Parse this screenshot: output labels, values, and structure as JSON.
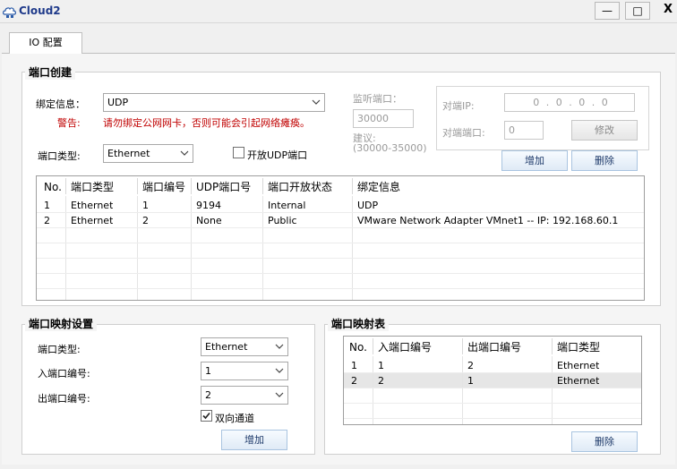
{
  "window": {
    "title": "Cloud2",
    "min_label": "—",
    "max_label": "□",
    "close_label": "X"
  },
  "tabs": [
    {
      "label": "IO 配置"
    }
  ],
  "port_create": {
    "group_title": "端口创建",
    "binding_label": "绑定信息：",
    "binding_value": "UDP",
    "warning_label": "警告:",
    "warning_text": "请勿绑定公网网卡，否则可能会引起网络瘫痪。",
    "listen_port_label": "监听端口：",
    "listen_port_value": "30000",
    "suggest_label": "建议:",
    "suggest_range": "(30000-35000)",
    "peer_ip_label": "对端IP:",
    "peer_ip_value": "0 . 0 . 0 . 0",
    "peer_port_label": "对端端口:",
    "peer_port_value": "0",
    "modify_button": "修改",
    "port_type_label": "端口类型:",
    "port_type_value": "Ethernet",
    "open_udp_label": "开放UDP端口",
    "open_udp_checked": false,
    "add_button": "增加",
    "delete_button": "删除",
    "table": {
      "columns": [
        "No.",
        "端口类型",
        "端口编号",
        "UDP端口号",
        "端口开放状态",
        "绑定信息"
      ],
      "rows": [
        [
          "1",
          "Ethernet",
          "1",
          "9194",
          "Internal",
          "UDP"
        ],
        [
          "2",
          "Ethernet",
          "2",
          "None",
          "Public",
          "VMware Network Adapter VMnet1 -- IP: 192.168.60.1"
        ]
      ]
    }
  },
  "port_mapping_settings": {
    "group_title": "端口映射设置",
    "port_type_label": "端口类型:",
    "port_type_value": "Ethernet",
    "in_port_label": "入端口编号:",
    "in_port_value": "1",
    "out_port_label": "出端口编号:",
    "out_port_value": "2",
    "bidirectional_label": "双向通道",
    "bidirectional_checked": true,
    "add_button": "增加"
  },
  "port_mapping_table": {
    "group_title": "端口映射表",
    "columns": [
      "No.",
      "入端口编号",
      "出端口编号",
      "端口类型"
    ],
    "rows": [
      [
        "1",
        "1",
        "2",
        "Ethernet"
      ],
      [
        "2",
        "2",
        "1",
        "Ethernet"
      ]
    ],
    "selected_row": 1,
    "delete_button": "删除"
  }
}
